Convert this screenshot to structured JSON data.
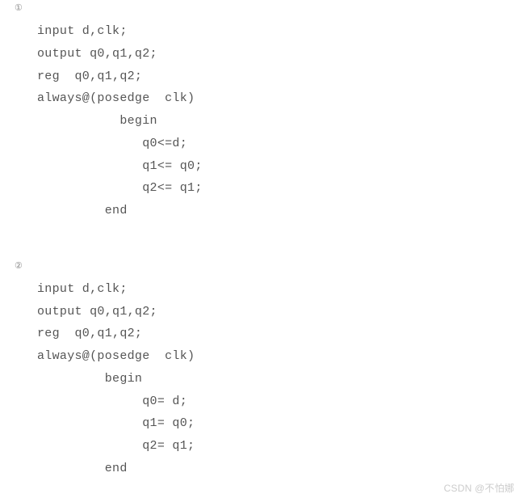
{
  "blocks": [
    {
      "marker": "①",
      "code": "input d,clk;\noutput q0,q1,q2;\nreg  q0,q1,q2;\nalways@(posedge  clk)\n           begin\n              q0<=d;\n              q1<= q0;\n              q2<= q1;\n         end"
    },
    {
      "marker": "②",
      "code": "input d,clk;\noutput q0,q1,q2;\nreg  q0,q1,q2;\nalways@(posedge  clk)\n         begin\n              q0= d;\n              q1= q0;\n              q2= q1;\n         end"
    }
  ],
  "watermark": "CSDN @不怕娜"
}
